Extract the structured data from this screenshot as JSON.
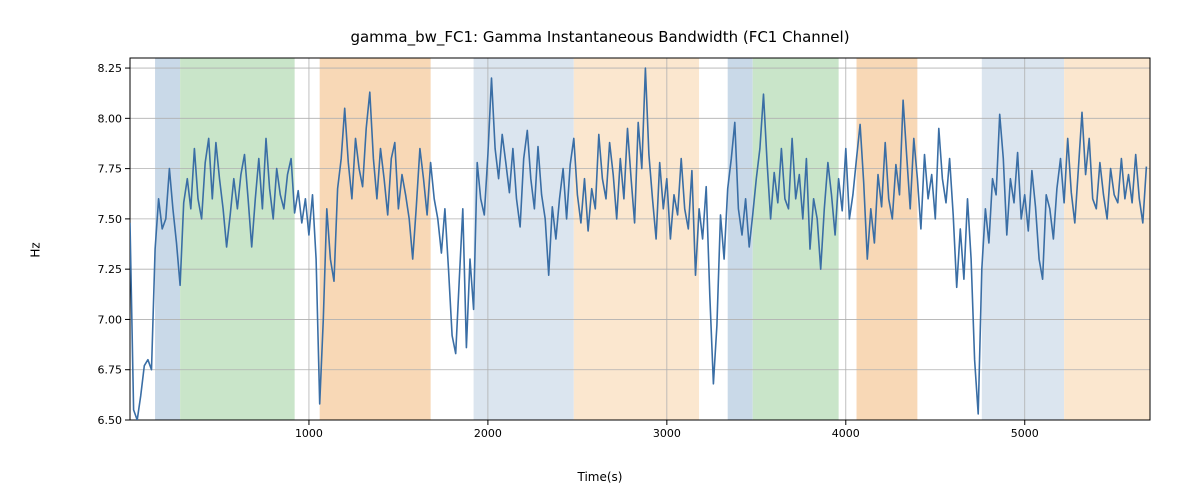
{
  "chart_data": {
    "type": "line",
    "title": "gamma_bw_FC1: Gamma Instantaneous Bandwidth (FC1 Channel)",
    "xlabel": "Time(s)",
    "ylabel": "Hz",
    "xlim": [
      0,
      5700
    ],
    "ylim": [
      6.5,
      8.3
    ],
    "xticks": [
      1000,
      2000,
      3000,
      4000,
      5000
    ],
    "yticks": [
      6.5,
      6.75,
      7.0,
      7.25,
      7.5,
      7.75,
      8.0,
      8.25
    ],
    "background_bands": [
      {
        "x0": 140,
        "x1": 280,
        "color": "#c9d9e8"
      },
      {
        "x0": 280,
        "x1": 920,
        "color": "#c9e5c9"
      },
      {
        "x0": 1060,
        "x1": 1680,
        "color": "#f8d8b6"
      },
      {
        "x0": 1920,
        "x1": 2480,
        "color": "#dbe5ef"
      },
      {
        "x0": 2480,
        "x1": 3180,
        "color": "#fbe7cf"
      },
      {
        "x0": 3340,
        "x1": 3480,
        "color": "#c9d9e8"
      },
      {
        "x0": 3480,
        "x1": 3960,
        "color": "#c9e5c9"
      },
      {
        "x0": 4060,
        "x1": 4400,
        "color": "#f8d8b6"
      },
      {
        "x0": 4760,
        "x1": 5220,
        "color": "#dbe5ef"
      },
      {
        "x0": 5220,
        "x1": 5700,
        "color": "#fbe7cf"
      }
    ],
    "series": [
      {
        "name": "gamma_bw_FC1",
        "color": "#3a6ea5",
        "x_step": 20,
        "values": [
          7.48,
          6.55,
          6.5,
          6.62,
          6.77,
          6.8,
          6.75,
          7.35,
          7.6,
          7.45,
          7.5,
          7.75,
          7.55,
          7.38,
          7.17,
          7.58,
          7.7,
          7.55,
          7.85,
          7.6,
          7.5,
          7.78,
          7.9,
          7.6,
          7.88,
          7.7,
          7.55,
          7.36,
          7.52,
          7.7,
          7.55,
          7.72,
          7.82,
          7.6,
          7.36,
          7.6,
          7.8,
          7.55,
          7.9,
          7.65,
          7.5,
          7.75,
          7.62,
          7.55,
          7.72,
          7.8,
          7.53,
          7.64,
          7.48,
          7.6,
          7.42,
          7.62,
          7.3,
          6.58,
          7.0,
          7.55,
          7.3,
          7.19,
          7.65,
          7.8,
          8.05,
          7.78,
          7.6,
          7.9,
          7.75,
          7.66,
          7.95,
          8.13,
          7.8,
          7.6,
          7.85,
          7.7,
          7.52,
          7.8,
          7.88,
          7.55,
          7.72,
          7.62,
          7.5,
          7.3,
          7.56,
          7.85,
          7.7,
          7.52,
          7.78,
          7.6,
          7.5,
          7.33,
          7.55,
          7.25,
          6.92,
          6.83,
          7.2,
          7.55,
          6.86,
          7.3,
          7.05,
          7.78,
          7.6,
          7.52,
          7.82,
          8.2,
          7.85,
          7.7,
          7.92,
          7.78,
          7.63,
          7.85,
          7.6,
          7.46,
          7.8,
          7.94,
          7.7,
          7.55,
          7.86,
          7.62,
          7.5,
          7.22,
          7.56,
          7.4,
          7.6,
          7.75,
          7.5,
          7.77,
          7.9,
          7.62,
          7.48,
          7.7,
          7.44,
          7.65,
          7.55,
          7.92,
          7.7,
          7.6,
          7.88,
          7.72,
          7.5,
          7.8,
          7.6,
          7.95,
          7.7,
          7.48,
          7.98,
          7.75,
          8.25,
          7.82,
          7.6,
          7.4,
          7.78,
          7.55,
          7.7,
          7.4,
          7.62,
          7.52,
          7.8,
          7.55,
          7.45,
          7.74,
          7.22,
          7.55,
          7.4,
          7.66,
          7.12,
          6.68,
          6.97,
          7.52,
          7.3,
          7.65,
          7.8,
          7.98,
          7.55,
          7.42,
          7.6,
          7.36,
          7.52,
          7.7,
          7.85,
          8.12,
          7.78,
          7.5,
          7.73,
          7.58,
          7.85,
          7.6,
          7.55,
          7.9,
          7.6,
          7.72,
          7.5,
          7.8,
          7.35,
          7.6,
          7.5,
          7.25,
          7.55,
          7.78,
          7.62,
          7.42,
          7.7,
          7.54,
          7.85,
          7.5,
          7.62,
          7.8,
          7.97,
          7.68,
          7.3,
          7.55,
          7.38,
          7.72,
          7.56,
          7.88,
          7.6,
          7.5,
          7.77,
          7.62,
          8.09,
          7.82,
          7.55,
          7.9,
          7.7,
          7.45,
          7.82,
          7.6,
          7.72,
          7.5,
          7.95,
          7.7,
          7.58,
          7.8,
          7.52,
          7.16,
          7.45,
          7.2,
          7.6,
          7.3,
          6.8,
          6.53,
          7.25,
          7.55,
          7.38,
          7.7,
          7.62,
          8.02,
          7.8,
          7.42,
          7.7,
          7.58,
          7.83,
          7.5,
          7.62,
          7.44,
          7.74,
          7.56,
          7.3,
          7.2,
          7.62,
          7.55,
          7.4,
          7.65,
          7.8,
          7.58,
          7.9,
          7.63,
          7.48,
          7.75,
          8.03,
          7.72,
          7.9,
          7.6,
          7.55,
          7.78,
          7.62,
          7.5,
          7.75,
          7.62,
          7.58,
          7.8,
          7.6,
          7.72,
          7.58,
          7.82,
          7.6,
          7.48,
          7.76
        ]
      }
    ]
  }
}
